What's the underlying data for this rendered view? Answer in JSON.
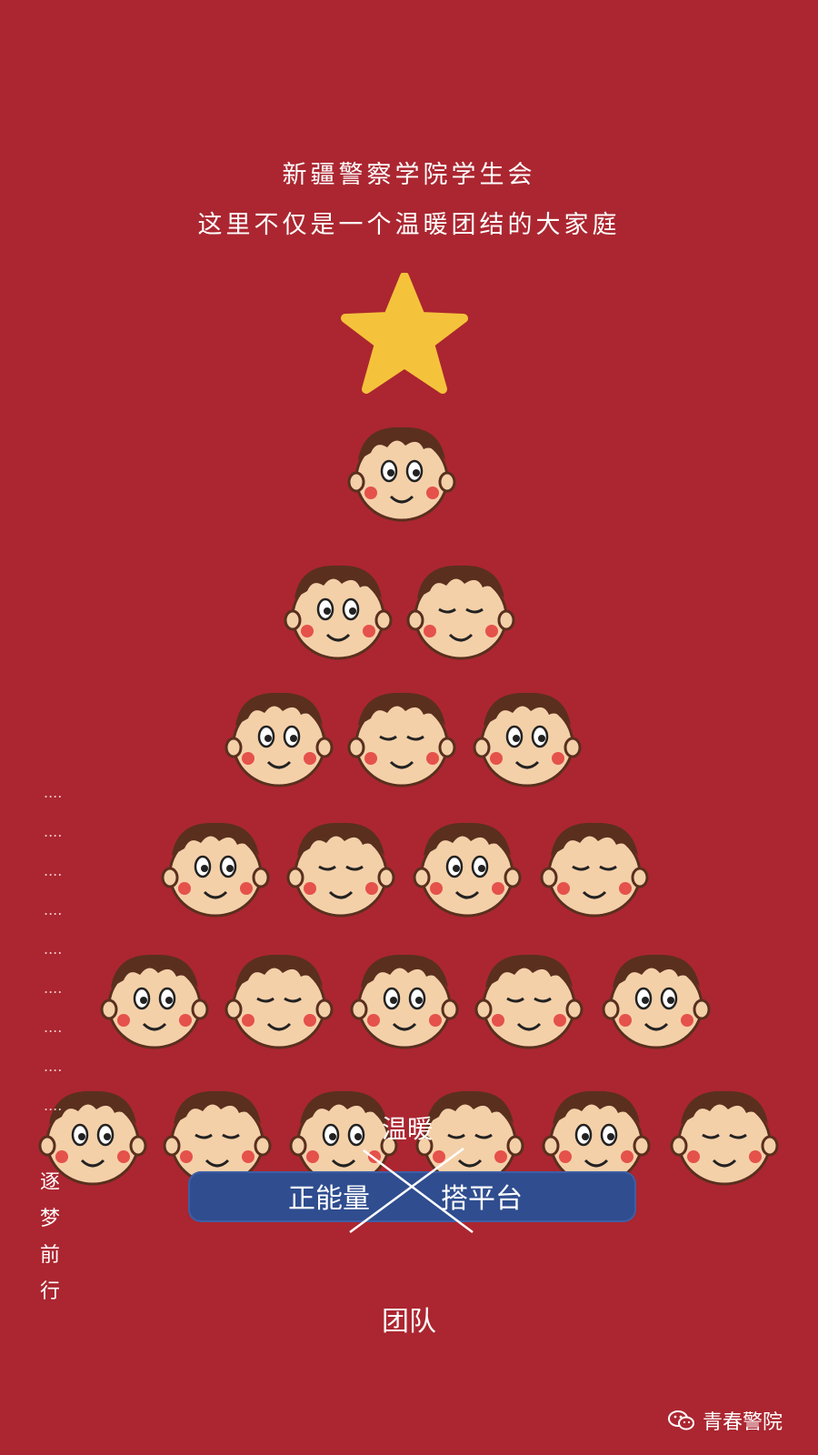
{
  "header": {
    "line1": "新疆警察学院学生会",
    "line2": "这里不仅是一个温暖团结的大家庭"
  },
  "side": {
    "dots": [
      "....",
      "....",
      "....",
      "....",
      "....",
      "....",
      "....",
      "....",
      "...."
    ],
    "vertical": [
      "逐",
      "梦",
      "前",
      "行"
    ]
  },
  "banner": {
    "above": "温暖",
    "left": "正能量",
    "right": "搭平台",
    "below": "团队"
  },
  "watermark": {
    "icon": "wechat-icon",
    "text": "青春警院"
  },
  "colors": {
    "background": "#ab2630",
    "star": "#f5c33b",
    "skin": "#f4d0a9",
    "hair": "#5a2f1e",
    "banner": "#2f4d8f"
  }
}
